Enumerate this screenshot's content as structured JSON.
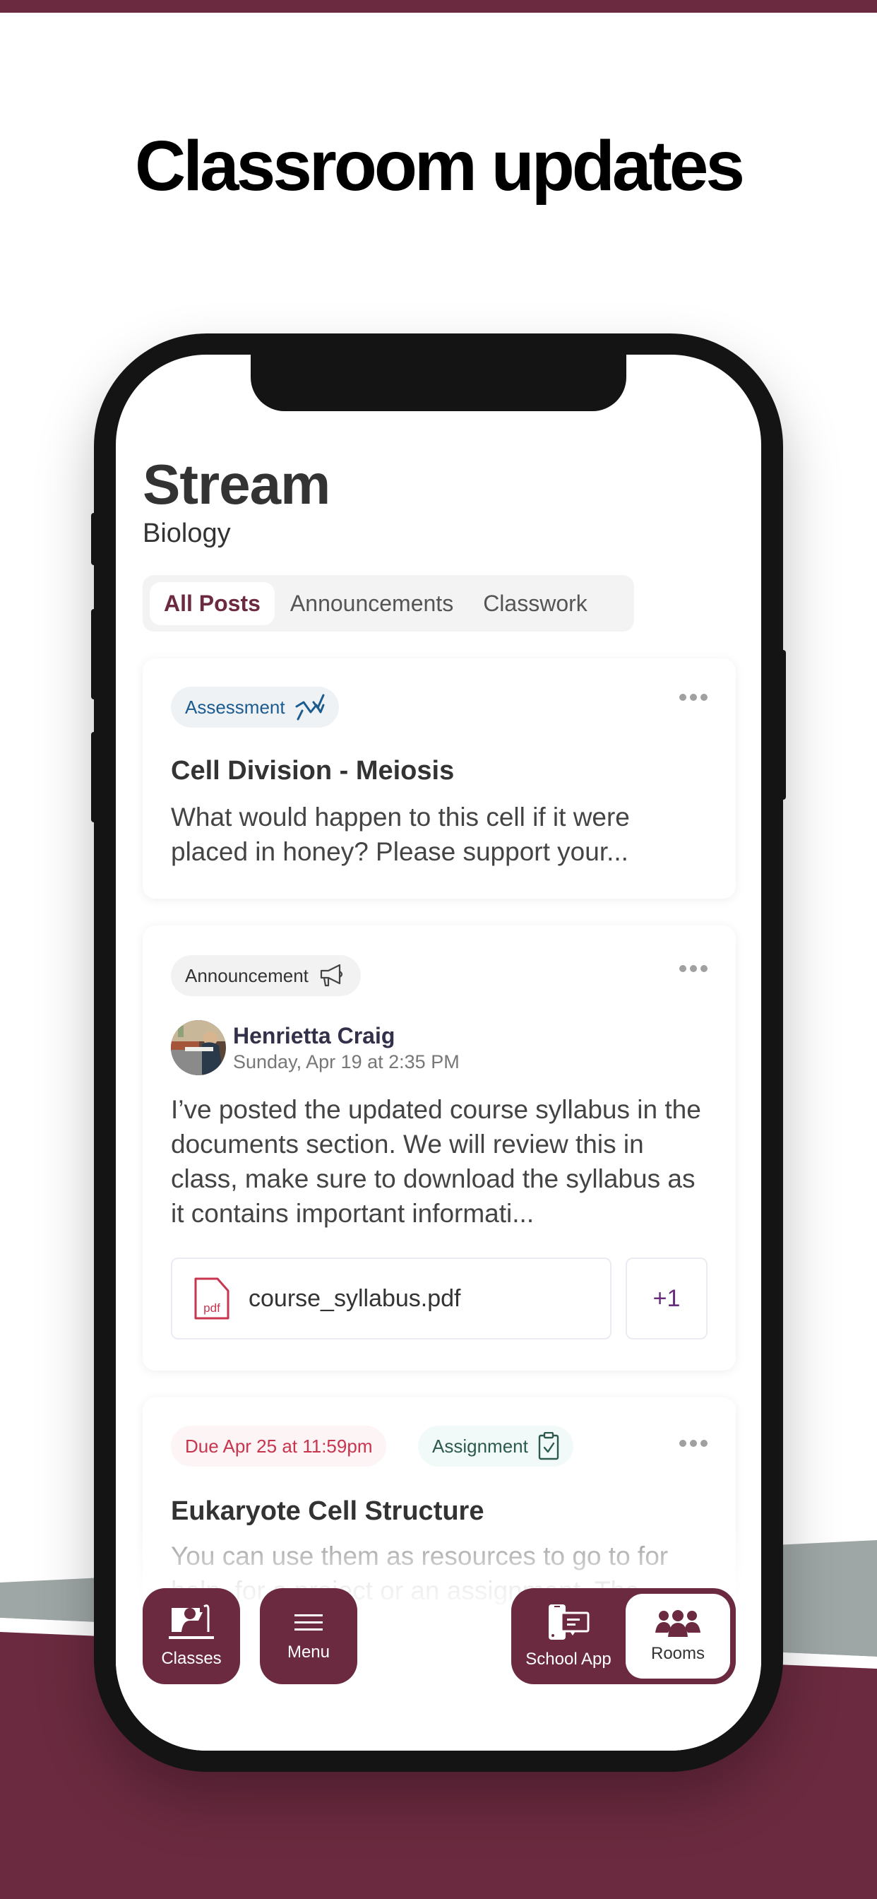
{
  "headline": "Classroom updates",
  "colors": {
    "brand": "#6b2a3f",
    "assessment": "#1c5b8e",
    "due": "#c7354f",
    "assignment": "#2d5a4e"
  },
  "app": {
    "title": "Stream",
    "subtitle": "Biology",
    "tabs": [
      {
        "label": "All Posts",
        "active": true
      },
      {
        "label": "Announcements",
        "active": false
      },
      {
        "label": "Classwork",
        "active": false
      }
    ]
  },
  "posts": [
    {
      "type": "assessment",
      "chip_label": "Assessment",
      "chip_icon": "trend-line-icon",
      "title": "Cell Division - Meiosis",
      "body": "What would happen to this cell if it were placed in honey? Please support your..."
    },
    {
      "type": "announcement",
      "chip_label": "Announcement",
      "chip_icon": "megaphone-icon",
      "author": "Henrietta Craig",
      "date": "Sunday, Apr 19 at 2:35 PM",
      "body": "I’ve posted the updated course syllabus in the documents section. We will review this in class, make sure to download the syllabus as it contains important informati...",
      "attachment": {
        "name": "course_syllabus.pdf",
        "icon_label": "pdf",
        "extra_count": "+1"
      }
    },
    {
      "type": "assignment",
      "due_label": "Due Apr 25 at 11:59pm",
      "chip_label": "Assignment",
      "chip_icon": "clipboard-check-icon",
      "title": "Eukaryote Cell Structure",
      "body": "You can use them as resources to go to for help, for a project or an assignment. The"
    }
  ],
  "bottom_nav": {
    "classes": "Classes",
    "menu": "Menu",
    "school_app": "School App",
    "rooms": "Rooms",
    "active": "Rooms"
  }
}
